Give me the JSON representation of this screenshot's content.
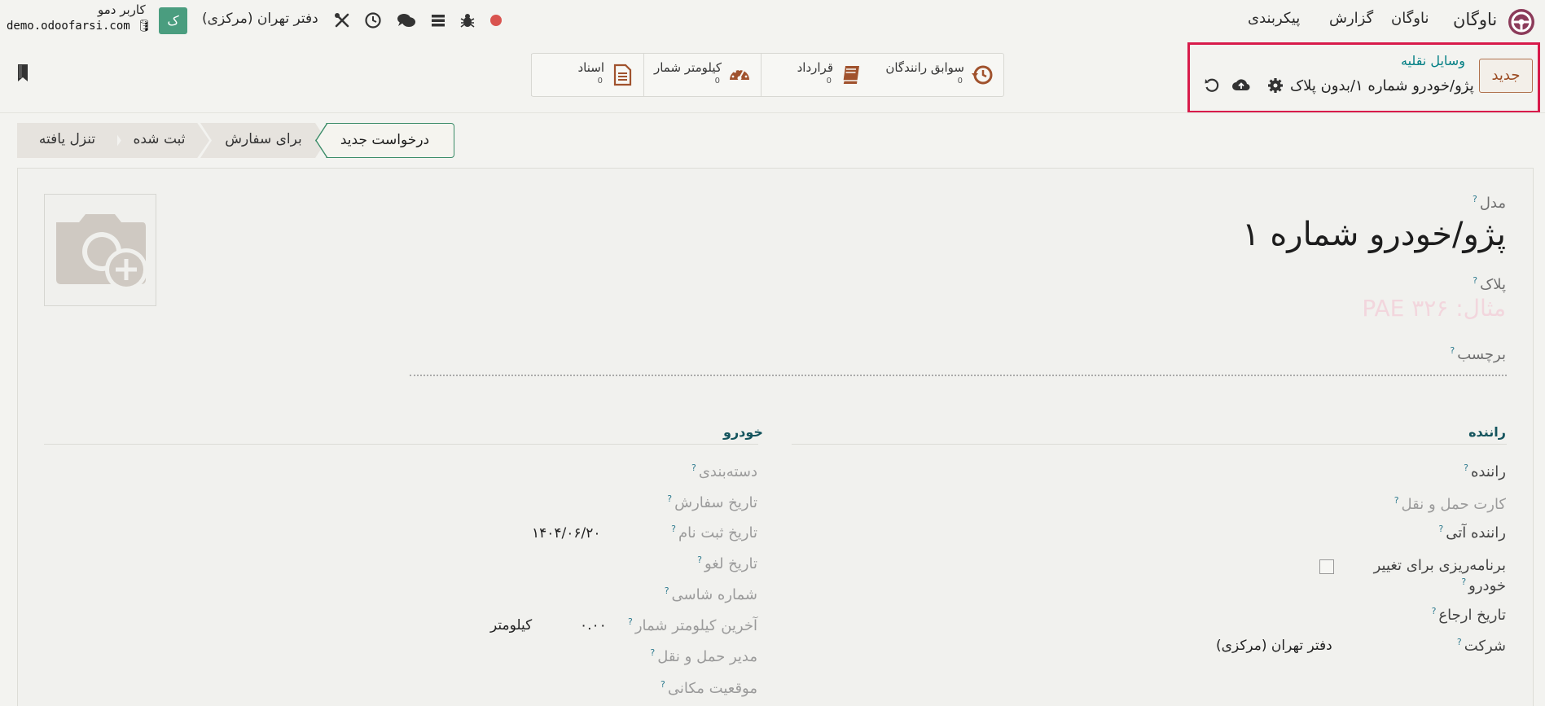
{
  "navbar": {
    "app_name": "ناوگان",
    "menus": [
      "ناوگان",
      "گزارش",
      "پیکربندی"
    ],
    "company": "دفتر تهران (مرکزی)",
    "user": {
      "initial": "ک",
      "name": "کاربر دمو",
      "db": "demo.odoofarsi.com"
    },
    "icons": [
      "record-dot-icon",
      "bug-icon",
      "list-icon",
      "chat-icon",
      "clock-icon",
      "tools-icon"
    ],
    "record_dot_color": "#d9534f"
  },
  "control_panel": {
    "new_button": "جدید",
    "breadcrumb_parent": "وسایل نقلیه",
    "breadcrumb_current": "پژو/خودرو شماره ۱/بدون پلاک",
    "smart_buttons": [
      {
        "label": "سوابق رانندگان",
        "value": "0",
        "icon": "history-icon"
      },
      {
        "label": "قرارداد",
        "value": "0",
        "icon": "book-icon"
      },
      {
        "label": "کیلومتر شمار",
        "value": "0",
        "icon": "dashboard-icon"
      },
      {
        "label": "اسناد",
        "value": "0",
        "icon": "document-icon"
      }
    ],
    "highlight_color": "#d81b4b",
    "accent_color": "#017e84"
  },
  "status_bar": {
    "stages": [
      "درخواست جدید",
      "برای سفارش",
      "ثبت شده",
      "تنزل یافته"
    ],
    "active_index": 0
  },
  "form": {
    "model_label": "مدل",
    "model_value": "پژو/خودرو شماره ۱",
    "plate_label": "پلاک",
    "plate_placeholder": "مثال: PAE ۳۲۶",
    "tag_label": "برچسب",
    "help_mark": "?",
    "driver_section": {
      "title": "راننده",
      "fields": {
        "driver": "راننده",
        "transport_card": "کارت حمل و نقل",
        "future_driver": "راننده آتی",
        "plan_change_1": "برنامه‌ریزی برای تغییر",
        "plan_change_2": "خودرو",
        "return_date": "تاریخ ارجاع",
        "company": "شرکت",
        "company_value": "دفتر تهران (مرکزی)"
      }
    },
    "vehicle_section": {
      "title": "خودرو",
      "fields": {
        "category": "دسته‌بندی",
        "order_date": "تاریخ سفارش",
        "registration_date": "تاریخ ثبت نام",
        "registration_value": "۱۴۰۴/۰۶/۲۰",
        "cancel_date": "تاریخ لغو",
        "chassis": "شماره شاسی",
        "last_odometer": "آخرین کیلومتر شمار",
        "odometer_value": "۰.۰۰",
        "odometer_unit": "کیلومتر",
        "fleet_manager": "مدیر حمل و نقل",
        "location": "موقعیت مکانی"
      }
    }
  }
}
